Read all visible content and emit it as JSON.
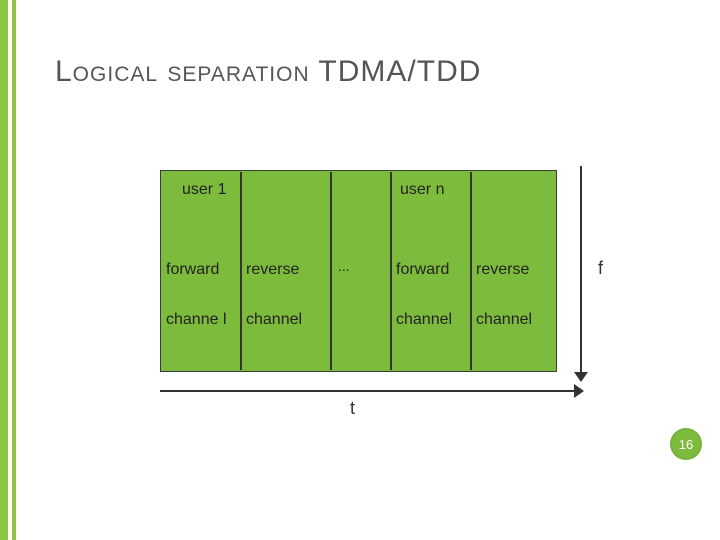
{
  "title": "Logical separation TDMA/TDD",
  "diagram": {
    "user1": "user 1",
    "usern": "user n",
    "dots": "...",
    "forward": "forward",
    "reverse": "reverse",
    "channel_wrapped": "channe l",
    "channel": "channel",
    "axis_f": "f",
    "axis_t": "t"
  },
  "page_number": "16",
  "colors": {
    "accent": "#8ec641",
    "box": "#7dbb3d"
  },
  "chart_data": {
    "type": "table",
    "description": "TDMA/TDD logical separation: time axis divided into slots per user, each user slot split into forward channel and reverse channel; single frequency band on f axis.",
    "axes": {
      "x": "t",
      "y": "f"
    },
    "users": [
      {
        "name": "user 1",
        "slots": [
          "forward channel",
          "reverse channel"
        ]
      },
      {
        "name": "...",
        "slots": []
      },
      {
        "name": "user n",
        "slots": [
          "forward channel",
          "reverse channel"
        ]
      }
    ]
  }
}
